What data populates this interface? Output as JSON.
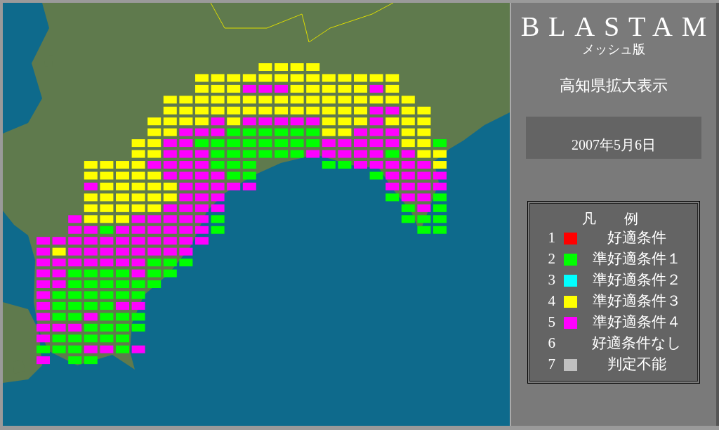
{
  "header": {
    "title": "BLASTAM",
    "subtitle": "メッシュ版",
    "region": "高知県拡大表示",
    "date": "2007年5月6日"
  },
  "legend": {
    "title": "凡　　例",
    "items": [
      {
        "number": "1",
        "color": "#ff0000",
        "label": "好適条件"
      },
      {
        "number": "2",
        "color": "#00ff00",
        "label": "準好適条件１"
      },
      {
        "number": "3",
        "color": "#00ffff",
        "label": "準好適条件２"
      },
      {
        "number": "4",
        "color": "#ffff00",
        "label": "準好適条件３"
      },
      {
        "number": "5",
        "color": "#ff00ff",
        "label": "準好適条件４"
      },
      {
        "number": "6",
        "label": "好適条件なし"
      },
      {
        "number": "7",
        "color": "#c0c0c0",
        "label": "判定不能"
      }
    ]
  }
}
